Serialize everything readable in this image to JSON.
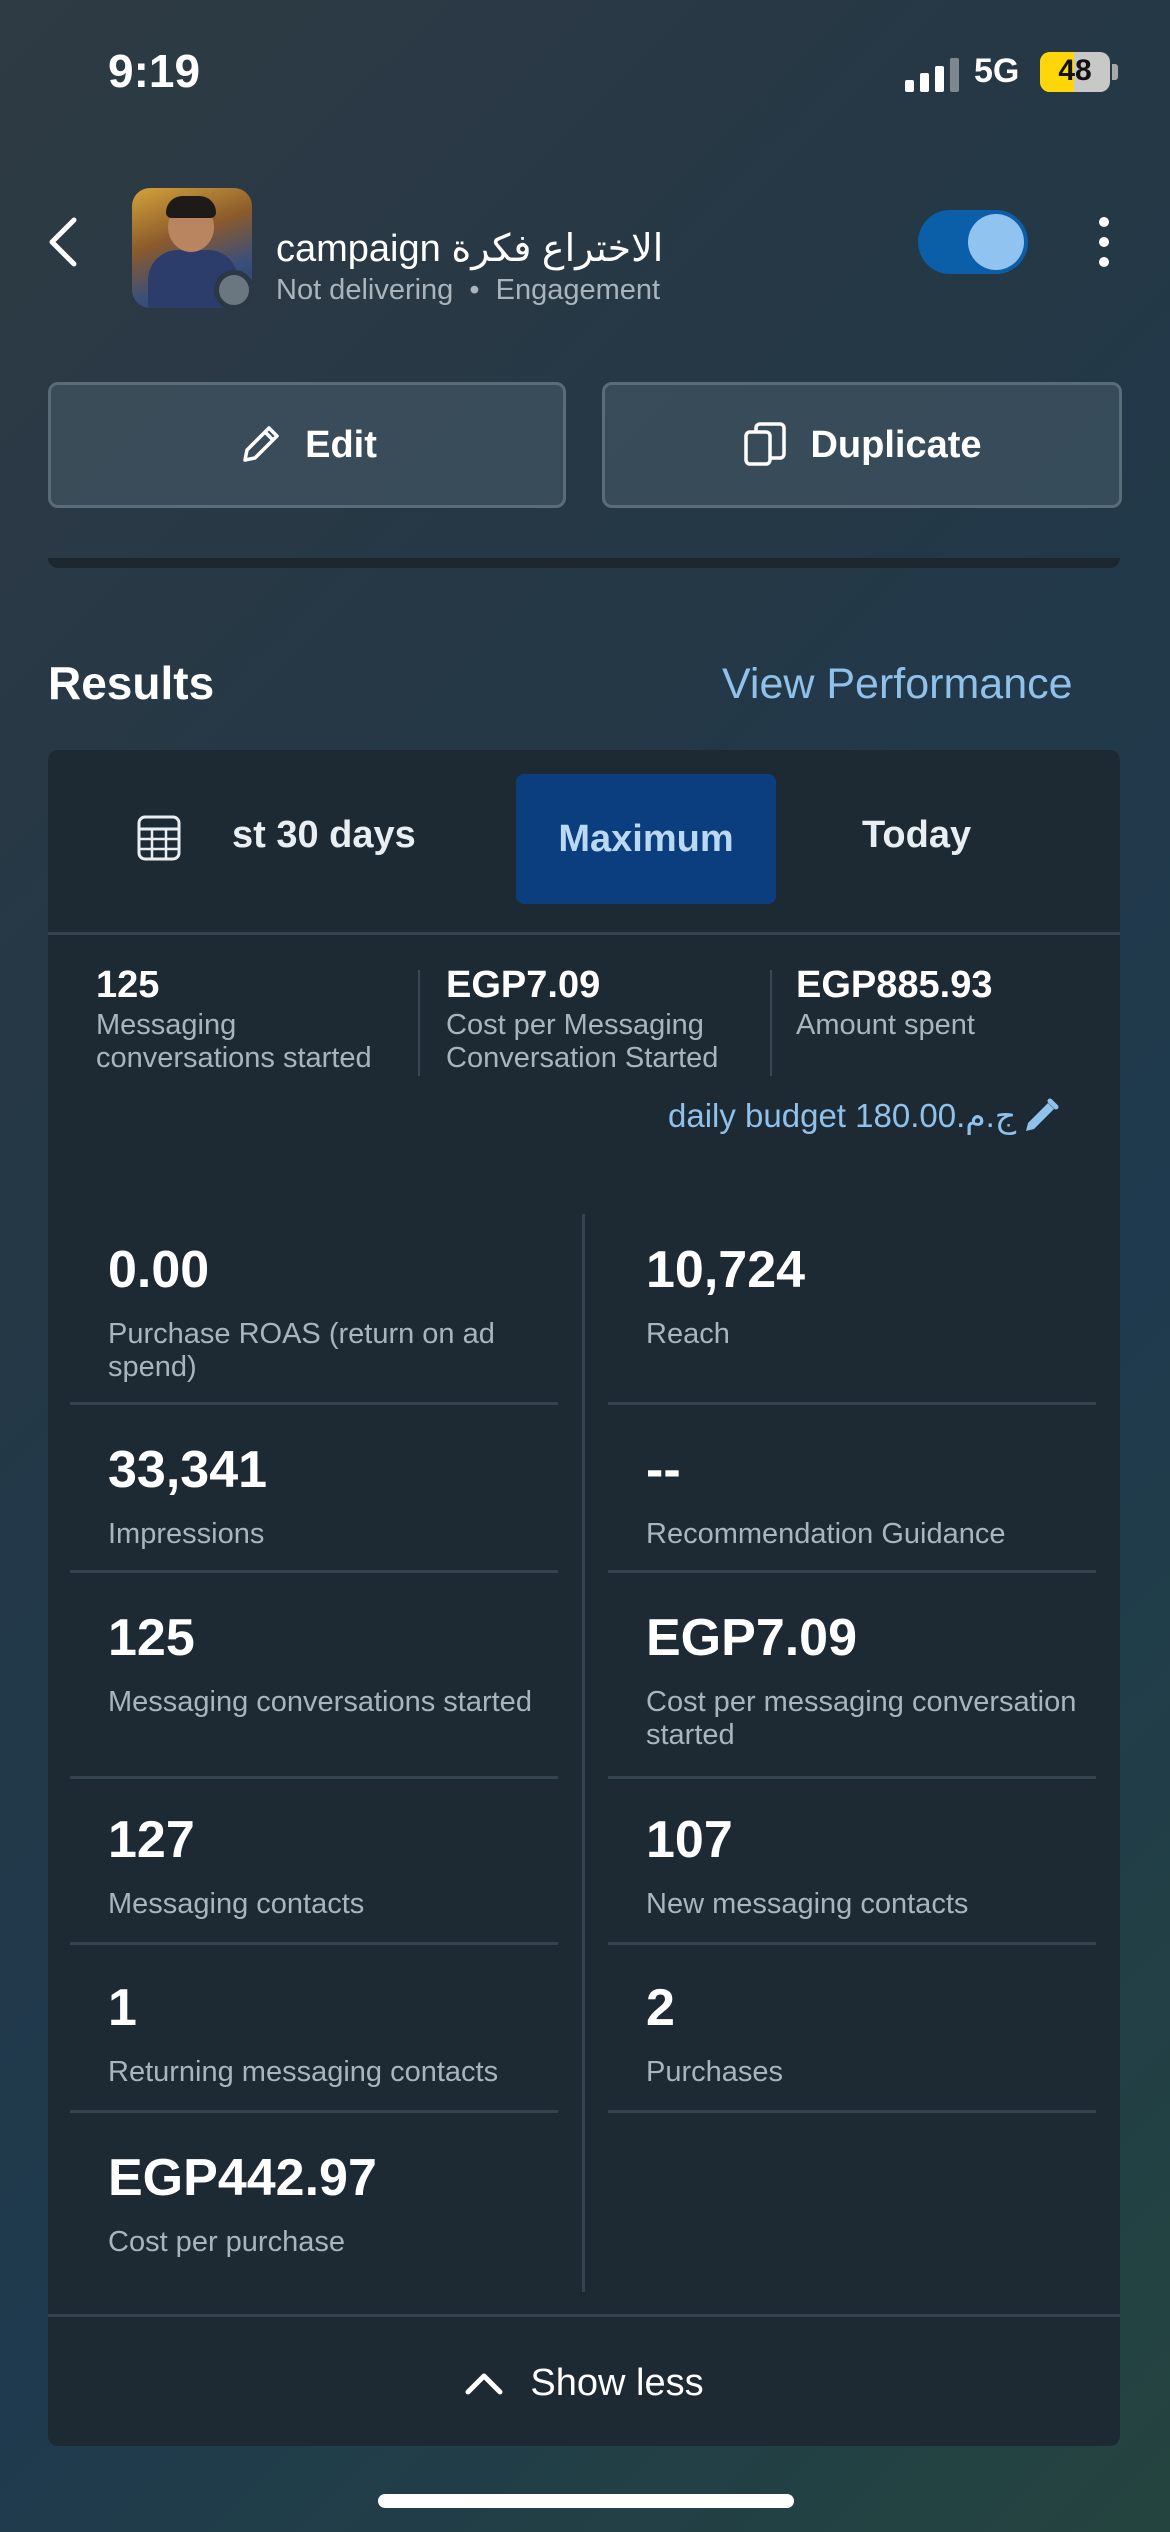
{
  "status_bar": {
    "time": "9:19",
    "network": "5G",
    "battery": "48",
    "battery_level_percent": 48
  },
  "header": {
    "campaign_title": "campaign الاختراع فكرة",
    "status": "Not delivering",
    "separator": "•",
    "objective": "Engagement",
    "toggle_on": true
  },
  "actions": {
    "edit_label": "Edit",
    "duplicate_label": "Duplicate"
  },
  "results": {
    "title": "Results",
    "view_performance": "View Performance"
  },
  "date_tabs": {
    "last_30": "st 30 days",
    "maximum": "Maximum",
    "today": "Today",
    "selected": "Maximum"
  },
  "summary": [
    {
      "value": "125",
      "label": "Messaging conversations started"
    },
    {
      "value": "EGP7.09",
      "label": "Cost per Messaging Conversation Started"
    },
    {
      "value": "EGP885.93",
      "label": "Amount spent"
    }
  ],
  "budget": "daily budget 180.00.ج.م",
  "metrics": {
    "left": [
      {
        "value": "0.00",
        "label": "Purchase ROAS (return on ad spend)"
      },
      {
        "value": "33,341",
        "label": "Impressions"
      },
      {
        "value": "125",
        "label": "Messaging conversations started"
      },
      {
        "value": "127",
        "label": "Messaging contacts"
      },
      {
        "value": "1",
        "label": "Returning messaging contacts"
      },
      {
        "value": "EGP442.97",
        "label": "Cost per purchase"
      }
    ],
    "right": [
      {
        "value": "10,724",
        "label": "Reach"
      },
      {
        "value": "--",
        "label": "Recommendation Guidance"
      },
      {
        "value": "EGP7.09",
        "label": "Cost per messaging conversation started"
      },
      {
        "value": "107",
        "label": "New messaging contacts"
      },
      {
        "value": "2",
        "label": "Purchases"
      }
    ]
  },
  "show_less": "Show less",
  "colors": {
    "accent": "#8fc1ea",
    "selected_tab": "#0b3e7e",
    "card": "#1d2a34",
    "toggle": "#0a5fa8"
  }
}
